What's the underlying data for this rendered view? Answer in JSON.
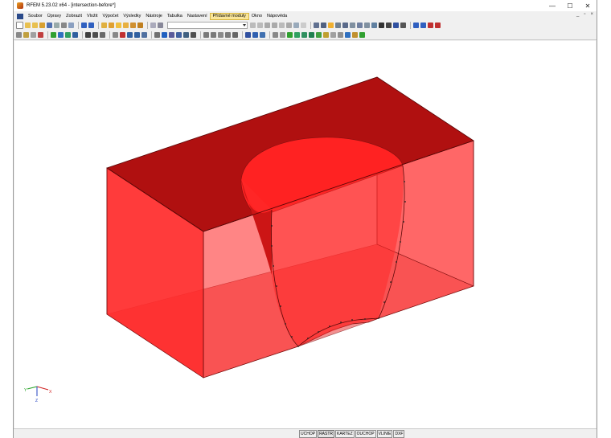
{
  "window": {
    "title": "RFEM 5.23.02 x64 - [intersection-before*]",
    "controls": {
      "minimize": "—",
      "maximize": "☐",
      "close": "✕"
    }
  },
  "menu": {
    "items": [
      "Soubor",
      "Úpravy",
      "Zobrazit",
      "Vložit",
      "Výpočet",
      "Výsledky",
      "Nástroje",
      "Tabulka",
      "Nastavení",
      "Přídavné moduly",
      "Okno",
      "Nápověda"
    ],
    "active": "Přídavné moduly",
    "mdi_controls": [
      "_",
      "▫",
      "×"
    ]
  },
  "toolbar": {
    "combo_value": ""
  },
  "axes": {
    "x": "X",
    "y": "Y",
    "z": "Z"
  },
  "status": {
    "buttons": [
      "UCHOP",
      "RASTR",
      "KARTEZ",
      "OUCHOP",
      "VLINIE",
      "DXF"
    ],
    "active": "RASTR"
  },
  "colors": {
    "solid_top": "#b01010",
    "solid_side": "#ff2020",
    "solid_bottom": "#f29090",
    "cylinder_face": "#ff3030"
  }
}
